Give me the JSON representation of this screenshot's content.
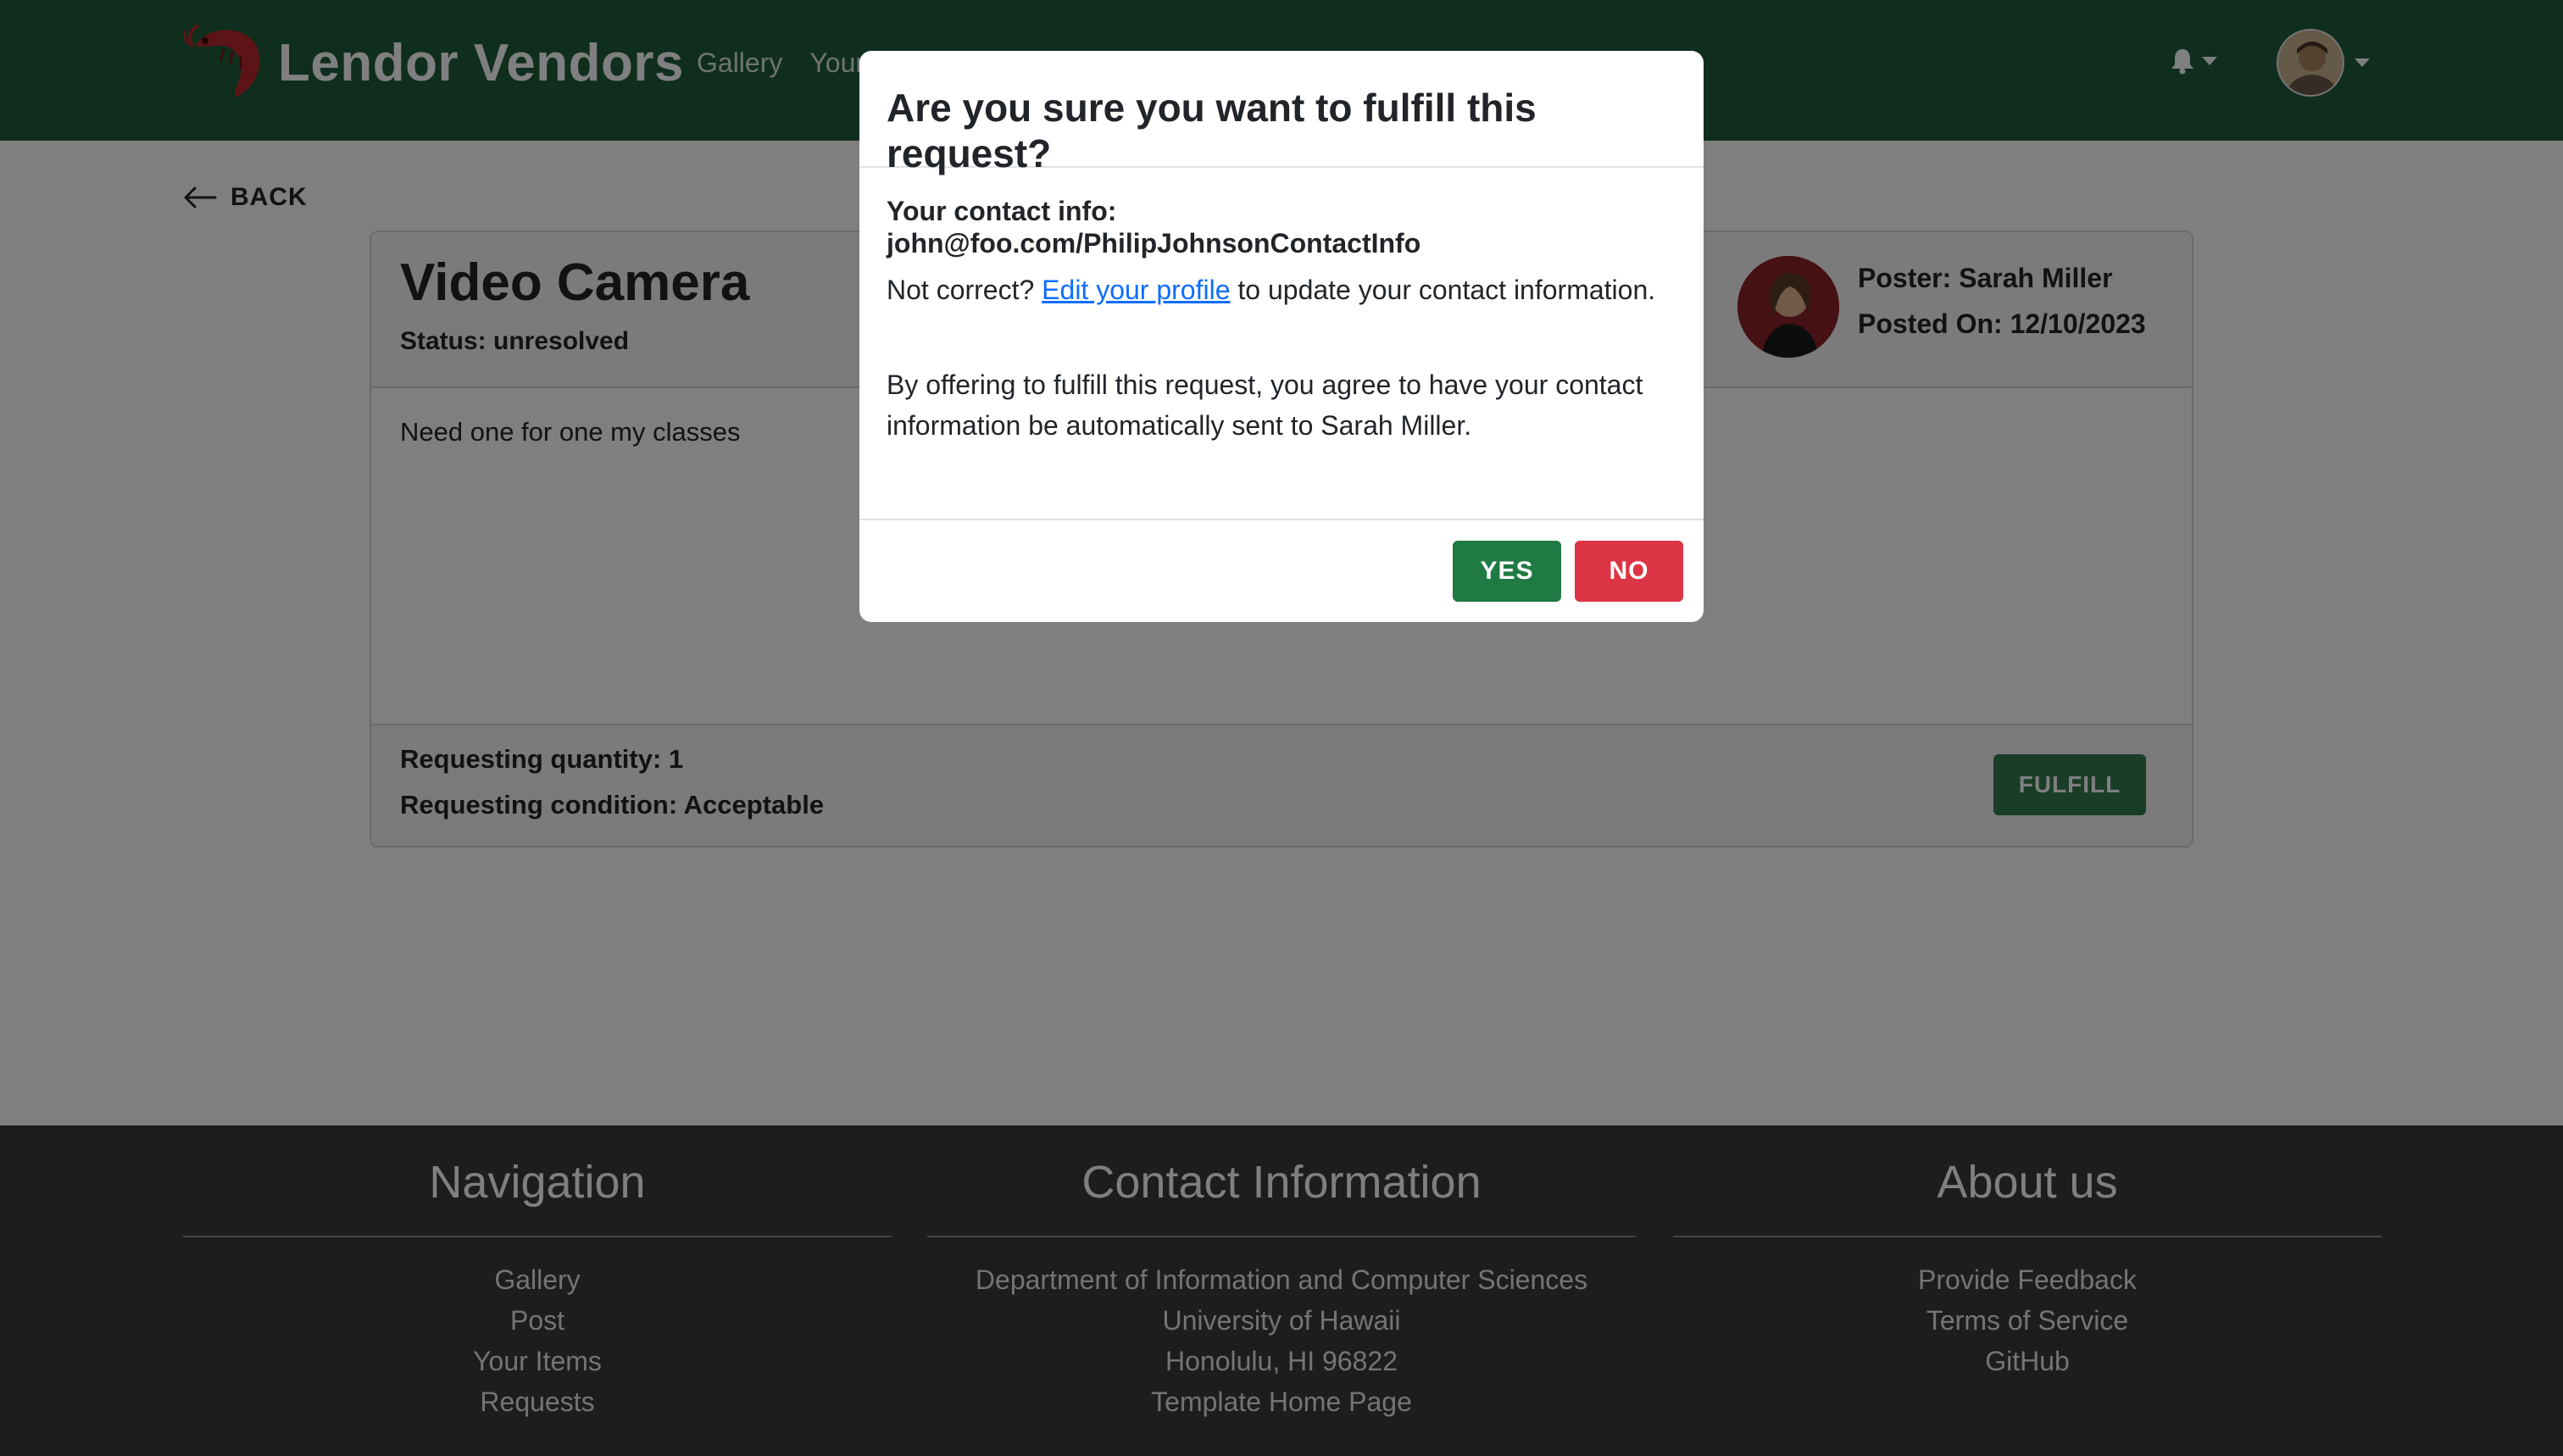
{
  "colors": {
    "navbar": "#1e5c3a",
    "primary_button": "#347a4f",
    "yes_button": "#1f7a43",
    "no_button": "#dc3545",
    "footer": "#3a3a3a",
    "link": "#0d6efd"
  },
  "navbar": {
    "brand": "Lendor Vendors",
    "logo_icon": "shrimp-icon",
    "links": [
      "Gallery",
      "Your Items"
    ],
    "bell_icon": "bell-icon"
  },
  "back": {
    "label": "BACK",
    "icon": "arrow-left-icon"
  },
  "item": {
    "title": "Video Camera",
    "status": "Status: unresolved",
    "poster": "Poster: Sarah Miller",
    "posted_on": "Posted On: 12/10/2023",
    "description": "Need one for one my classes",
    "quantity": "Requesting quantity: 1",
    "condition": "Requesting condition: Acceptable",
    "fulfill_label": "FULFILL"
  },
  "modal": {
    "title": "Are you sure you want to fulfill this request?",
    "contact_label": "Your contact info:",
    "contact_value": "john@foo.com/PhilipJohnsonContactInfo",
    "not_correct": "Not correct?",
    "edit_link": "Edit your profile",
    "update_text": "to update your contact information.",
    "agree_text": "By offering to fulfill this request, you agree to have your contact information be automatically sent to Sarah Miller.",
    "yes_label": "YES",
    "no_label": "NO"
  },
  "footer": {
    "navigation": {
      "heading": "Navigation",
      "items": [
        "Gallery",
        "Post",
        "Your Items",
        "Requests"
      ]
    },
    "contact": {
      "heading": "Contact Information",
      "items": [
        "Department of Information and Computer Sciences",
        "University of Hawaii",
        "Honolulu, HI 96822",
        "Template Home Page"
      ]
    },
    "about": {
      "heading": "About us",
      "items": [
        "Provide Feedback",
        "Terms of Service",
        "GitHub"
      ]
    }
  }
}
